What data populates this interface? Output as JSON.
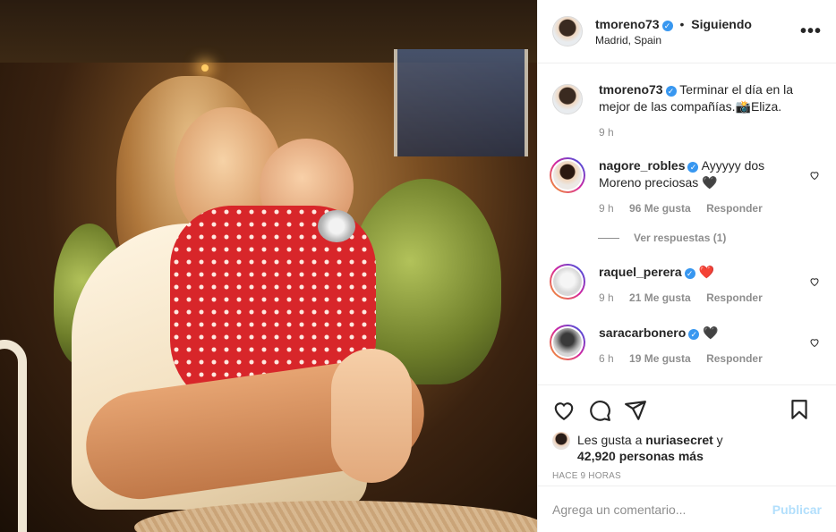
{
  "post": {
    "author": {
      "username": "tmoreno73",
      "verified_icon": "verified-badge-icon",
      "following_label": "Siguiendo",
      "location": "Madrid, Spain",
      "more_label": "•••"
    },
    "caption": {
      "username": "tmoreno73",
      "text": "Terminar el día en la mejor de las compañías.📸Eliza.",
      "time": "9 h"
    },
    "comments": [
      {
        "username": "nagore_robles",
        "text": "Ayyyyy dos Moreno preciosas 🖤",
        "time": "9 h",
        "likes": "96 Me gusta",
        "reply_label": "Responder",
        "view_replies": "Ver respuestas (1)"
      },
      {
        "username": "raquel_perera",
        "text": "❤️",
        "time": "9 h",
        "likes": "21 Me gusta",
        "reply_label": "Responder"
      },
      {
        "username": "saracarbonero",
        "text": "🖤",
        "time": "6 h",
        "likes": "19 Me gusta",
        "reply_label": "Responder"
      }
    ],
    "likes": {
      "prefix": "Les gusta a ",
      "user": "nuriasecret",
      "middle": " y ",
      "count": "42,920 personas más"
    },
    "timestamp": "HACE 9 HORAS",
    "composer": {
      "placeholder": "Agrega un comentario...",
      "publish_label": "Publicar"
    },
    "colors": {
      "accent": "#3897f0",
      "publish_disabled": "#b2dffc",
      "muted": "#8e8e8e",
      "text": "#262626"
    }
  }
}
